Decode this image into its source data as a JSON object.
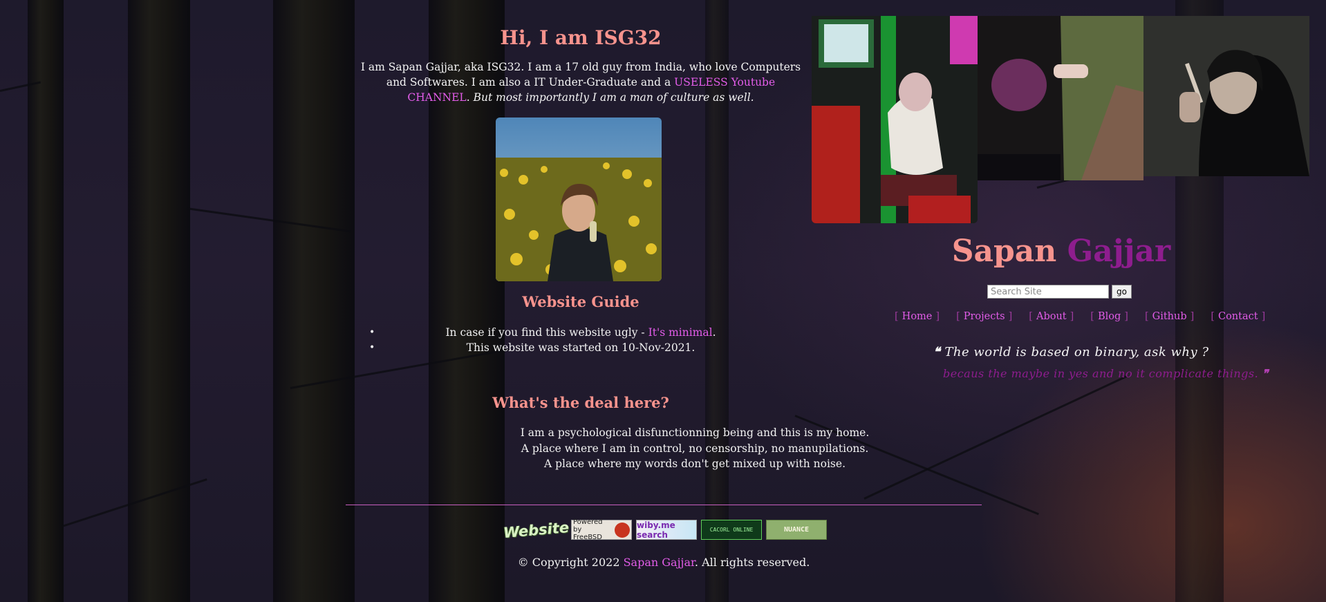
{
  "colors": {
    "heading": "#f7938d",
    "link": "#e25ce8",
    "brand_surname": "#8e1d8e",
    "text": "#f4f4f4",
    "divider": "#c85fc0"
  },
  "intro": {
    "title": "Hi, I am ISG32",
    "text_before_link": "I am Sapan Gajjar, aka ISG32. I am a 17 old guy from India, who love Computers and Softwares. I am also a IT Under-Graduate and a ",
    "link_text": "USELESS Youtube CHANNEL",
    "text_after_link": ". ",
    "italic_text": "But most importantly I am a man of culture as well."
  },
  "guide": {
    "title": "Website Guide",
    "item1_prefix": "In case if you find this website ugly - ",
    "item1_link": "It's minimal",
    "item1_suffix": ".",
    "item2": "This website was started on 10-Nov-2021."
  },
  "deal": {
    "title": "What's the deal here?",
    "lines": [
      "I am a psychological disfunctionning being and this is my home.",
      "A place where I am in control, no censorship, no manupilations.",
      "A place where my words don't get mixed up with noise."
    ]
  },
  "badges": [
    "Website",
    "Powered by FreeBSD",
    "wiby.me search",
    "CACORL ONLINE",
    "NUANCE"
  ],
  "footer": {
    "prefix": "© Copyright 2022 ",
    "link": "Sapan Gajjar",
    "suffix": ". All rights reserved."
  },
  "brand": {
    "first": "Sapan",
    "last": "Gajjar"
  },
  "search": {
    "placeholder": "Search Site",
    "button": "go"
  },
  "nav": {
    "items": [
      "Home",
      "Projects",
      "About",
      "Blog",
      "Github",
      "Contact"
    ]
  },
  "quote": {
    "line1": "The world is based on binary, ask why ?",
    "line2": "becaus the maybe in yes and no it complicate things."
  },
  "photo_icons": [
    "arcade-girl-photo",
    "tshirt-photo",
    "smoking-girl-photo",
    "portrait-photo"
  ]
}
